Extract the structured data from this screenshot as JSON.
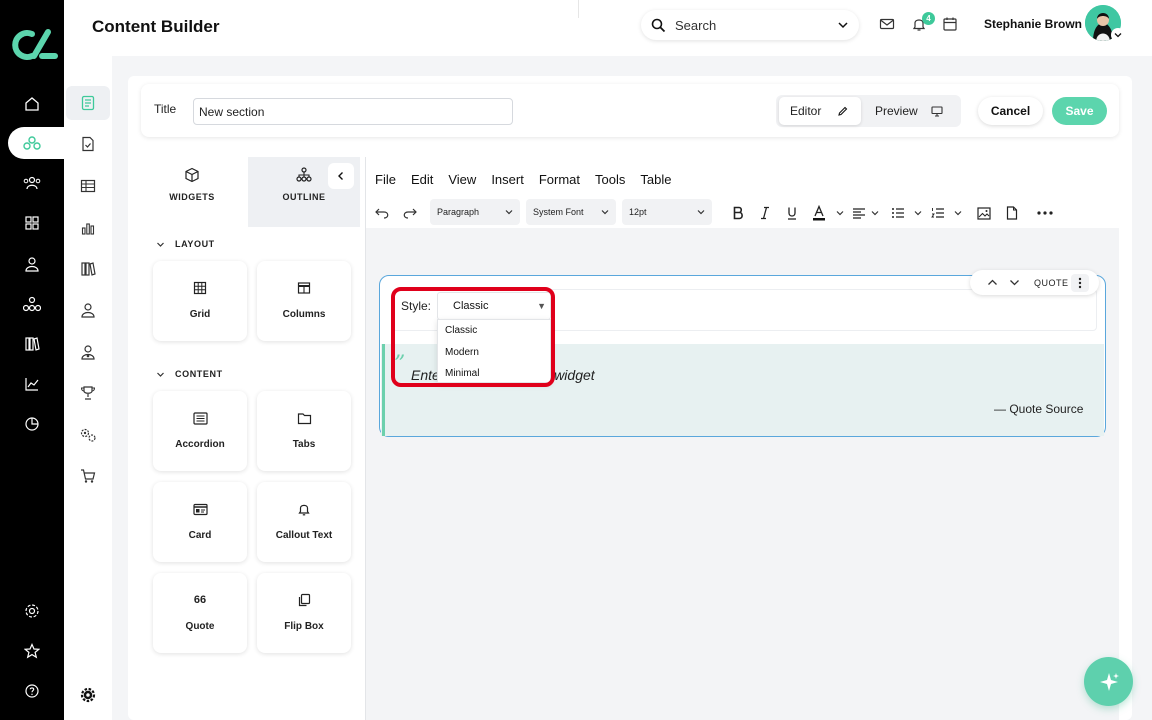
{
  "header": {
    "page_title": "Content Builder",
    "search_placeholder": "Search",
    "notification_count": "4",
    "user_name": "Stephanie Brown"
  },
  "title_bar": {
    "title_label": "Title",
    "title_value": "New section",
    "editor_label": "Editor",
    "preview_label": "Preview",
    "cancel_label": "Cancel",
    "save_label": "Save"
  },
  "widgets_panel": {
    "tabs": [
      {
        "label": "WIDGETS",
        "icon": "cube-icon"
      },
      {
        "label": "OUTLINE",
        "icon": "hierarchy-icon"
      }
    ],
    "sections": [
      {
        "title": "LAYOUT",
        "items": [
          {
            "label": "Grid",
            "icon": "grid-icon"
          },
          {
            "label": "Columns",
            "icon": "columns-icon"
          }
        ]
      },
      {
        "title": "CONTENT",
        "items": [
          {
            "label": "Accordion",
            "icon": "accordion-icon"
          },
          {
            "label": "Tabs",
            "icon": "folder-icon"
          },
          {
            "label": "Card",
            "icon": "card-icon"
          },
          {
            "label": "Callout Text",
            "icon": "bell-icon"
          },
          {
            "label": "Quote",
            "icon_text": "66"
          },
          {
            "label": "Flip Box",
            "icon": "copy-icon"
          }
        ]
      }
    ]
  },
  "editor": {
    "menu": [
      "File",
      "Edit",
      "View",
      "Insert",
      "Format",
      "Tools",
      "Table"
    ],
    "block_format": "Paragraph",
    "font_family": "System Font",
    "font_size": "12pt"
  },
  "quote_widget": {
    "control_label": "QUOTE",
    "style_label": "Style:",
    "style_selected": "Classic",
    "style_options": [
      "Classic",
      "Modern",
      "Minimal"
    ],
    "quote_mark": "”",
    "quote_text": "Enter quote text in this widget",
    "quote_source": "— Quote Source"
  },
  "colors": {
    "accent": "#5cd5ad",
    "highlight": "#e0001b",
    "widget_border": "#5aa7dc"
  }
}
